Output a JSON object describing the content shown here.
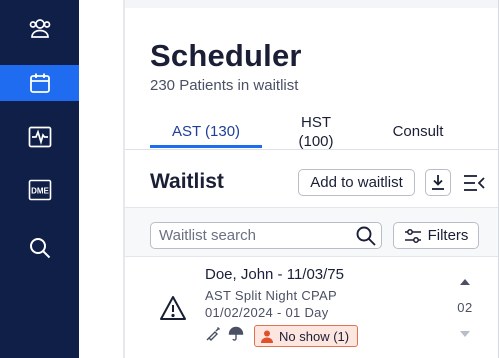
{
  "nav": {
    "items": [
      {
        "icon": "patients-group-icon",
        "active": false
      },
      {
        "icon": "calendar-icon",
        "active": true
      },
      {
        "icon": "activity-monitor-icon",
        "active": false
      },
      {
        "icon": "dme-icon",
        "label": "DME",
        "active": false
      },
      {
        "icon": "search-icon",
        "active": false
      }
    ]
  },
  "header": {
    "title": "Scheduler",
    "subtitle": "230 Patients in waitlist"
  },
  "tabs": [
    {
      "label": "AST (130)",
      "active": true
    },
    {
      "label_line1": "HST",
      "label_line2": "(100)",
      "active": false
    },
    {
      "label": "Consult",
      "active": false
    }
  ],
  "waitlist": {
    "title": "Waitlist",
    "add_button": "Add to waitlist",
    "download_icon": "download-icon",
    "collapse_icon": "collapse-panel-icon",
    "search_placeholder": "Waitlist search",
    "filters_button": "Filters"
  },
  "rows": [
    {
      "name": "Doe, John - 11/03/75",
      "study": "AST Split Night CPAP",
      "dates": "01/02/2024 - 01 Day",
      "status_icon": "warning-triangle-icon",
      "tag_icons": [
        "syringe-icon",
        "umbrella-icon"
      ],
      "badge": "No show (1)",
      "priority": "02"
    }
  ],
  "colors": {
    "rail_bg": "#0f1f47",
    "rail_active": "#1f6cf0",
    "accent": "#1f6cf0",
    "badge_bg": "#fde6df",
    "badge_border": "#e0734f",
    "badge_icon": "#e0502b"
  }
}
